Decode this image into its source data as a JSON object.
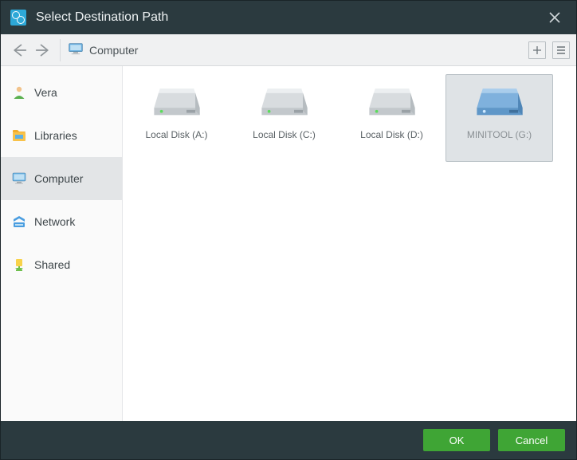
{
  "title": "Select Destination Path",
  "toolbar": {
    "path_label": "Computer"
  },
  "sidebar": {
    "items": [
      {
        "label": "Vera"
      },
      {
        "label": "Libraries"
      },
      {
        "label": "Computer"
      },
      {
        "label": "Network"
      },
      {
        "label": "Shared"
      }
    ],
    "selected_index": 2
  },
  "drives": [
    {
      "label": "Local Disk (A:)",
      "selected": false,
      "color": "gray"
    },
    {
      "label": "Local Disk (C:)",
      "selected": false,
      "color": "gray"
    },
    {
      "label": "Local Disk (D:)",
      "selected": false,
      "color": "gray"
    },
    {
      "label": "MINITOOL (G:)",
      "selected": true,
      "color": "blue"
    }
  ],
  "buttons": {
    "ok": "OK",
    "cancel": "Cancel"
  }
}
